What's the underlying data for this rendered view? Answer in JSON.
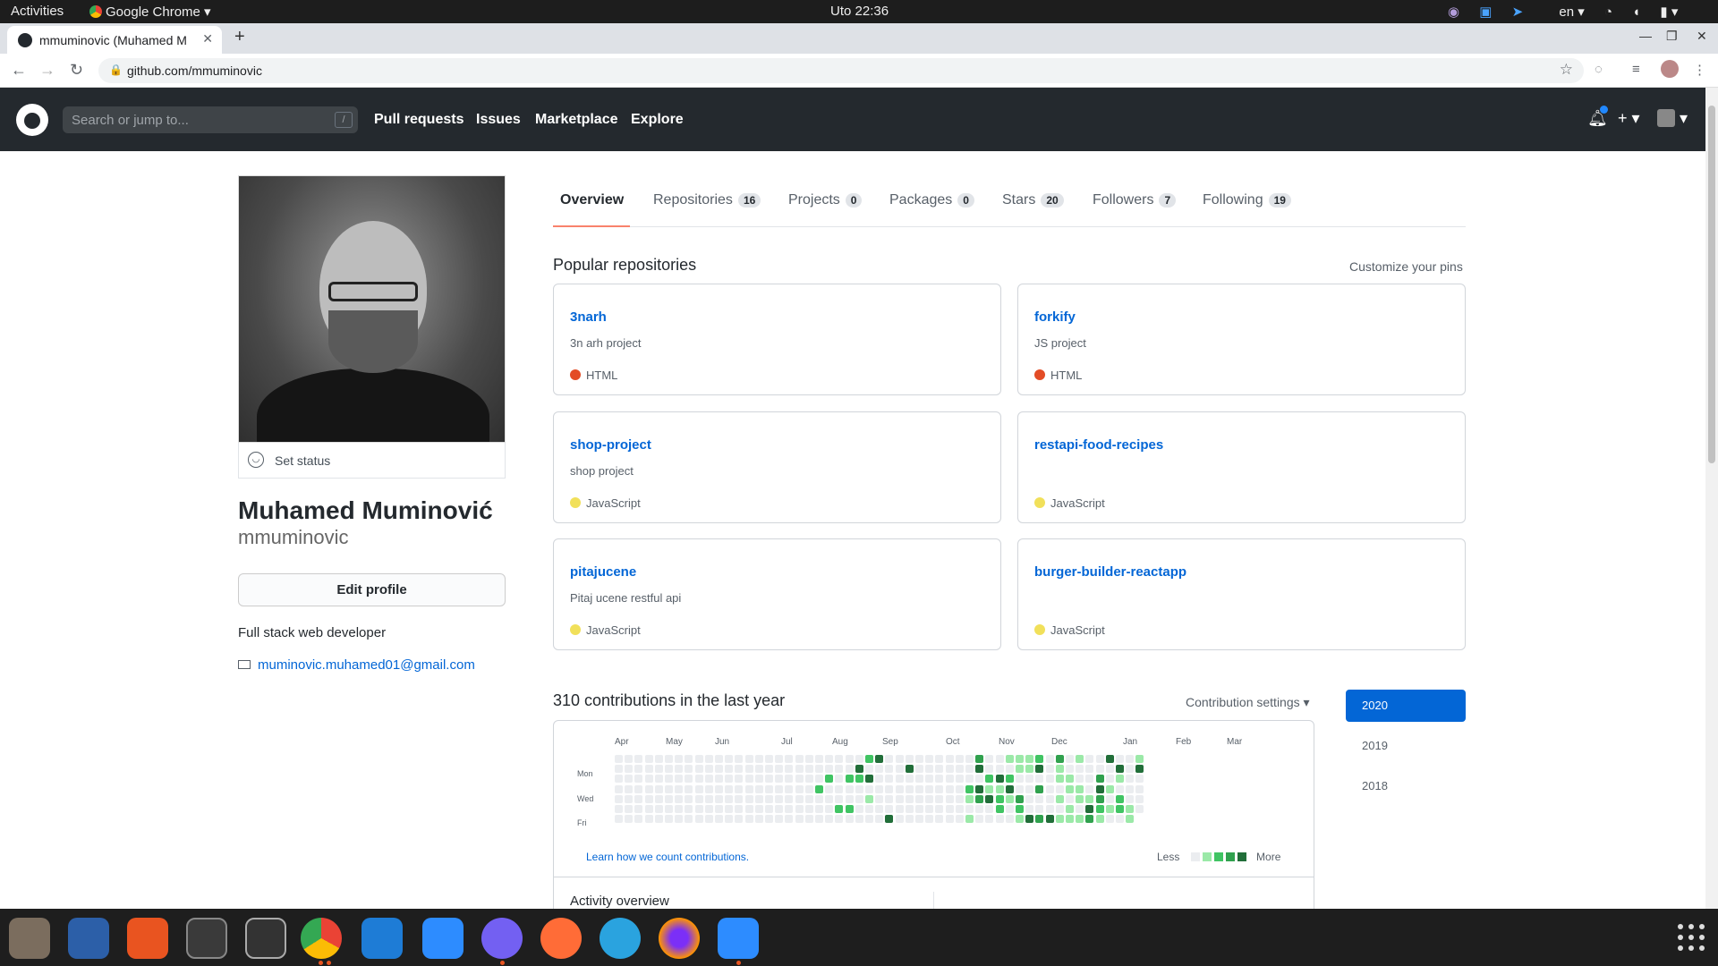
{
  "os": {
    "activities": "Activities",
    "app_menu": "Google Chrome",
    "clock": "Uto 22:36",
    "lang": "en"
  },
  "browser": {
    "tab_title": "mmuminovic (Muhamed M",
    "url": "github.com/mmuminovic"
  },
  "header": {
    "search_placeholder": "Search or jump to...",
    "search_key": "/",
    "nav": [
      "Pull requests",
      "Issues",
      "Marketplace",
      "Explore"
    ]
  },
  "profile": {
    "set_status": "Set status",
    "full_name": "Muhamed Muminović",
    "username": "mmuminovic",
    "edit_profile": "Edit profile",
    "bio": "Full stack web developer",
    "email": "muminovic.muhamed01@gmail.com"
  },
  "tabs": [
    {
      "label": "Overview",
      "count": ""
    },
    {
      "label": "Repositories",
      "count": "16"
    },
    {
      "label": "Projects",
      "count": "0"
    },
    {
      "label": "Packages",
      "count": "0"
    },
    {
      "label": "Stars",
      "count": "20"
    },
    {
      "label": "Followers",
      "count": "7"
    },
    {
      "label": "Following",
      "count": "19"
    }
  ],
  "pinned": {
    "title": "Popular repositories",
    "customize": "Customize your pins",
    "repos": [
      {
        "name": "3narh",
        "description": "3n arh project",
        "language": "HTML",
        "color": "#e34c26"
      },
      {
        "name": "forkify",
        "description": "JS project",
        "language": "HTML",
        "color": "#e34c26"
      },
      {
        "name": "shop-project",
        "description": "shop project",
        "language": "JavaScript",
        "color": "#f1e05a"
      },
      {
        "name": "restapi-food-recipes",
        "description": "",
        "language": "JavaScript",
        "color": "#f1e05a"
      },
      {
        "name": "pitajucene",
        "description": "Pitaj ucene restful api",
        "language": "JavaScript",
        "color": "#f1e05a"
      },
      {
        "name": "burger-builder-reactapp",
        "description": "",
        "language": "JavaScript",
        "color": "#f1e05a"
      }
    ]
  },
  "contributions": {
    "title": "310 contributions in the last year",
    "settings": "Contribution settings",
    "months": [
      "Apr",
      "May",
      "Jun",
      "Jul",
      "Aug",
      "Sep",
      "Oct",
      "Nov",
      "Dec",
      "Jan",
      "Feb",
      "Mar"
    ],
    "days": [
      "Mon",
      "Wed",
      "Fri"
    ],
    "learn_link": "Learn how we count contributions.",
    "less": "Less",
    "more": "More",
    "colors": [
      "#ebedf0",
      "#9be9a8",
      "#40c463",
      "#30a14e",
      "#216e39"
    ],
    "activity_overview": "Activity overview"
  },
  "years": [
    "2020",
    "2019",
    "2018"
  ]
}
